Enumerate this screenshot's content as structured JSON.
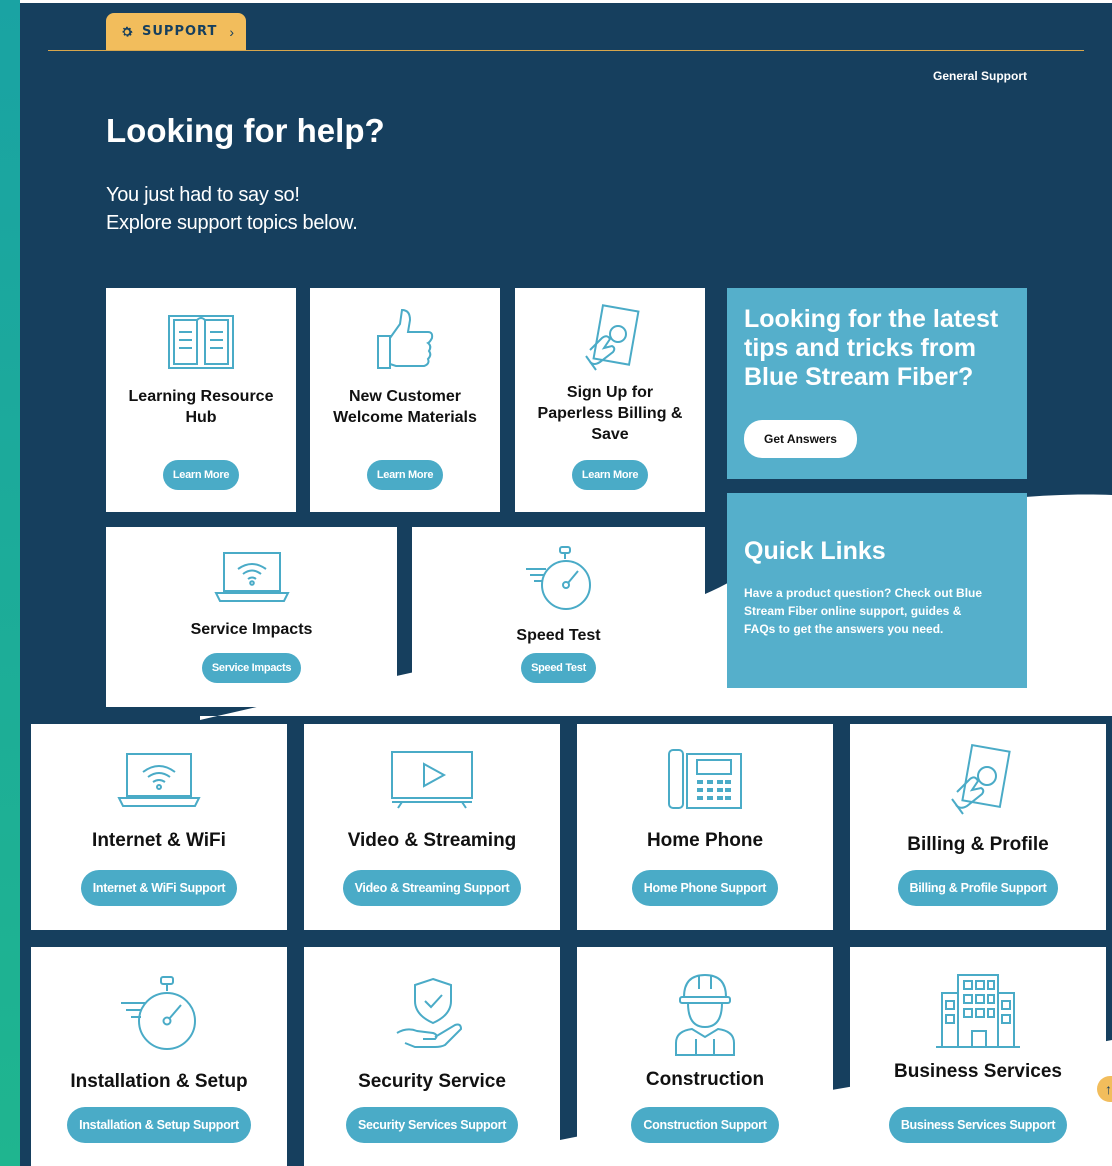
{
  "breadcrumb": {
    "label": "SUPPORT",
    "icon": "gear-icon",
    "chevron": "›"
  },
  "top_link": "General Support",
  "hero": {
    "title": "Looking for help?",
    "line1": "You just had to say so!",
    "line2": "Explore support topics below."
  },
  "featured_cards": [
    {
      "icon": "book-icon",
      "title_lines": [
        "Learning Resource",
        "Hub"
      ],
      "button": "Learn More"
    },
    {
      "icon": "thumbs-up-icon",
      "title_lines": [
        "New Customer",
        "Welcome Materials"
      ],
      "button": "Learn More"
    },
    {
      "icon": "bill-hand-icon",
      "title_lines": [
        "Sign Up for",
        "Paperless Billing &",
        "Save"
      ],
      "button": "Learn More"
    },
    {
      "icon": "laptop-wifi-icon",
      "title": "Service Impacts",
      "button": "Service Impacts"
    },
    {
      "icon": "stopwatch-icon",
      "title": "Speed Test",
      "button": "Speed Test"
    }
  ],
  "promo": {
    "title_lines": [
      "Looking for the latest",
      "tips and tricks from",
      "Blue Stream Fiber?"
    ],
    "button": "Get Answers"
  },
  "quick_links": {
    "title": "Quick Links",
    "text_lines": [
      "Have a product question? Check out Blue",
      "Stream Fiber online support, guides &",
      "FAQs to get the answers you need."
    ]
  },
  "categories": [
    {
      "icon": "laptop-wifi-icon",
      "title": "Internet & WiFi",
      "button": "Internet & WiFi Support"
    },
    {
      "icon": "tv-play-icon",
      "title": "Video & Streaming",
      "button": "Video & Streaming Support"
    },
    {
      "icon": "desk-phone-icon",
      "title": "Home Phone",
      "button": "Home Phone Support"
    },
    {
      "icon": "bill-hand-icon",
      "title": "Billing & Profile",
      "button": "Billing & Profile Support"
    },
    {
      "icon": "stopwatch-icon",
      "title": "Installation & Setup",
      "button": "Installation & Setup Support"
    },
    {
      "icon": "shield-hand-icon",
      "title": "Security Service",
      "button": "Security Services Support"
    },
    {
      "icon": "construction-worker-icon",
      "title": "Construction",
      "button": "Construction Support"
    },
    {
      "icon": "office-building-icon",
      "title": "Business Services",
      "button": "Business Services Support"
    }
  ],
  "colors": {
    "navy": "#163f5e",
    "teal": "#4aabc7",
    "promo_bg": "#55afcb",
    "accent": "#f2bd5c"
  }
}
